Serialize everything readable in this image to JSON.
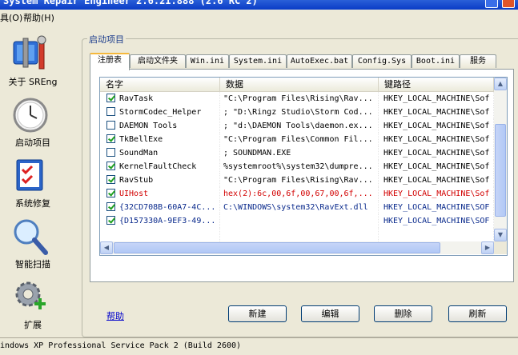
{
  "window": {
    "title": "System Repair Engineer 2.6.21.888 (2.6 RC 2)"
  },
  "menu": [
    {
      "label": "具(O)"
    },
    {
      "label": "帮助(H)"
    }
  ],
  "sidebar": {
    "items": [
      {
        "label": "关于 SREng",
        "icon": "tools-icon"
      },
      {
        "label": "启动项目",
        "icon": "clock-icon"
      },
      {
        "label": "系统修复",
        "icon": "checklist-icon"
      },
      {
        "label": "智能扫描",
        "icon": "magnifier-icon"
      },
      {
        "label": "扩展",
        "icon": "gear-plus-icon"
      }
    ]
  },
  "group": {
    "title": "启动项目"
  },
  "tabs": [
    {
      "label": "注册表",
      "active": true
    },
    {
      "label": "启动文件夹"
    },
    {
      "label": "Win.ini"
    },
    {
      "label": "System.ini"
    },
    {
      "label": "AutoExec.bat"
    },
    {
      "label": "Config.Sys"
    },
    {
      "label": "Boot.ini"
    },
    {
      "label": "服务"
    }
  ],
  "list": {
    "columns": [
      "名字",
      "数据",
      "键路径"
    ],
    "rows": [
      {
        "checked": true,
        "name": "RavTask",
        "data": "\"C:\\Program Files\\Rising\\Rav...",
        "path": "HKEY_LOCAL_MACHINE\\Sof",
        "color": "normal"
      },
      {
        "checked": false,
        "name": "StormCodec_Helper",
        "data": "; \"D:\\Ringz Studio\\Storm Cod...",
        "path": "HKEY_LOCAL_MACHINE\\Sof",
        "color": "normal"
      },
      {
        "checked": false,
        "name": "DAEMON Tools",
        "data": "; \"d:\\DAEMON Tools\\daemon.ex...",
        "path": "HKEY_LOCAL_MACHINE\\Sof",
        "color": "normal"
      },
      {
        "checked": true,
        "name": "TkBellExe",
        "data": "\"C:\\Program Files\\Common Fil...",
        "path": "HKEY_LOCAL_MACHINE\\Sof",
        "color": "normal"
      },
      {
        "checked": false,
        "name": "SoundMan",
        "data": "; SOUNDMAN.EXE",
        "path": "HKEY_LOCAL_MACHINE\\Sof",
        "color": "normal"
      },
      {
        "checked": true,
        "name": "KernelFaultCheck",
        "data": "%systemroot%\\system32\\dumpre...",
        "path": "HKEY_LOCAL_MACHINE\\Sof",
        "color": "normal"
      },
      {
        "checked": true,
        "name": "RavStub",
        "data": "\"C:\\Program Files\\Rising\\Rav...",
        "path": "HKEY_LOCAL_MACHINE\\Sof",
        "color": "normal"
      },
      {
        "checked": true,
        "name": "UIHost",
        "data": "hex(2):6c,00,6f,00,67,00,6f,...",
        "path": "HKEY_LOCAL_MACHINE\\Sof",
        "color": "red"
      },
      {
        "checked": true,
        "name": "{32CD708B-60A7-4C...",
        "data": "C:\\WINDOWS\\system32\\RavExt.dll",
        "path": "HKEY_LOCAL_MACHINE\\SOF",
        "color": "blue"
      },
      {
        "checked": true,
        "name": "{D157330A-9EF3-49...",
        "data": "",
        "path": "HKEY_LOCAL_MACHINE\\SOF",
        "color": "blue"
      }
    ]
  },
  "footer": {
    "help": "帮助",
    "buttons": [
      "新建",
      "编辑",
      "删除",
      "刷新"
    ]
  },
  "statusbar": {
    "text": "indows XP Professional Service Pack 2 (Build 2600)"
  },
  "colors": {
    "accent": "#0a3cc6",
    "error": "#d20000",
    "link": "#0000cc"
  }
}
